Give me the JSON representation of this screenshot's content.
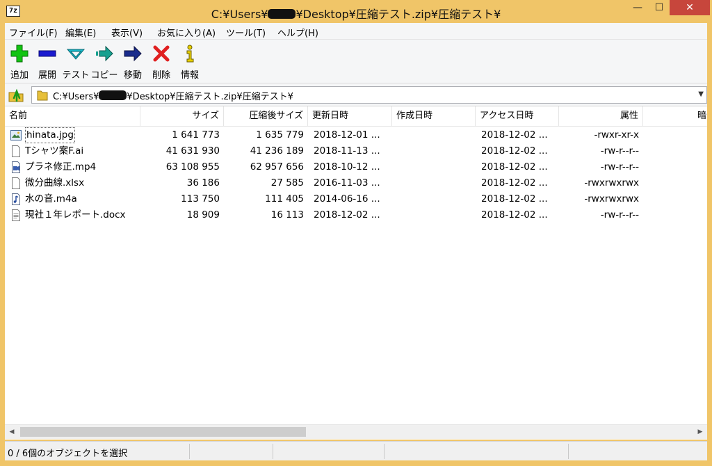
{
  "window": {
    "app_icon": "7z",
    "title_prefix": "C:¥Users¥",
    "title_suffix": "¥Desktop¥圧縮テスト.zip¥圧縮テスト¥",
    "min_glyph": "—",
    "max_glyph": "☐",
    "close_glyph": "✕"
  },
  "menu": [
    {
      "label": "ファイル(F)"
    },
    {
      "label": "編集(E)"
    },
    {
      "label": "表示(V)"
    },
    {
      "label": "お気に入り(A)"
    },
    {
      "label": "ツール(T)"
    },
    {
      "label": "ヘルプ(H)"
    }
  ],
  "toolbar": [
    {
      "label": "追加",
      "icon": "add-icon",
      "color": "#12c412"
    },
    {
      "label": "展開",
      "icon": "extract-icon",
      "color": "#1b1bd0"
    },
    {
      "label": "テスト",
      "icon": "test-icon",
      "color": "#18b8c8"
    },
    {
      "label": "コピー",
      "icon": "copy-icon",
      "color": "#17a08f"
    },
    {
      "label": "移動",
      "icon": "move-icon",
      "color": "#1a2c8c"
    },
    {
      "label": "削除",
      "icon": "delete-icon",
      "color": "#e02020"
    },
    {
      "label": "情報",
      "icon": "info-icon",
      "color": "#e8d000"
    }
  ],
  "address": {
    "prefix": "C:¥Users¥",
    "suffix": "¥Desktop¥圧縮テスト.zip¥圧縮テスト¥"
  },
  "columns": [
    "名前",
    "サイズ",
    "圧縮後サイズ",
    "更新日時",
    "作成日時",
    "アクセス日時",
    "属性",
    "暗号"
  ],
  "files": [
    {
      "name": "hinata.jpg",
      "size": "1 641 773",
      "packed": "1 635 779",
      "modified": "2018-12-01 ...",
      "created": "",
      "accessed": "2018-12-02 ...",
      "attr": "-rwxr-xr-x",
      "icon": "image-file-icon"
    },
    {
      "name": "Tシャツ案F.ai",
      "size": "41 631 930",
      "packed": "41 236 189",
      "modified": "2018-11-13 ...",
      "created": "",
      "accessed": "2018-12-02 ...",
      "attr": "-rw-r--r--",
      "icon": "document-file-icon"
    },
    {
      "name": "プラネ修正.mp4",
      "size": "63 108 955",
      "packed": "62 957 656",
      "modified": "2018-10-12 ...",
      "created": "",
      "accessed": "2018-12-02 ...",
      "attr": "-rw-r--r--",
      "icon": "video-file-icon"
    },
    {
      "name": "微分曲線.xlsx",
      "size": "36 186",
      "packed": "27 585",
      "modified": "2016-11-03 ...",
      "created": "",
      "accessed": "2018-12-02 ...",
      "attr": "-rwxrwxrwx",
      "icon": "document-file-icon"
    },
    {
      "name": "水の音.m4a",
      "size": "113 750",
      "packed": "111 405",
      "modified": "2014-06-16 ...",
      "created": "",
      "accessed": "2018-12-02 ...",
      "attr": "-rwxrwxrwx",
      "icon": "audio-file-icon"
    },
    {
      "name": "現社１年レポート.docx",
      "size": "18 909",
      "packed": "16 113",
      "modified": "2018-12-02 ...",
      "created": "",
      "accessed": "2018-12-02 ...",
      "attr": "-rw-r--r--",
      "icon": "text-file-icon"
    }
  ],
  "status": {
    "text": "0 / 6個のオブジェクトを選択"
  }
}
